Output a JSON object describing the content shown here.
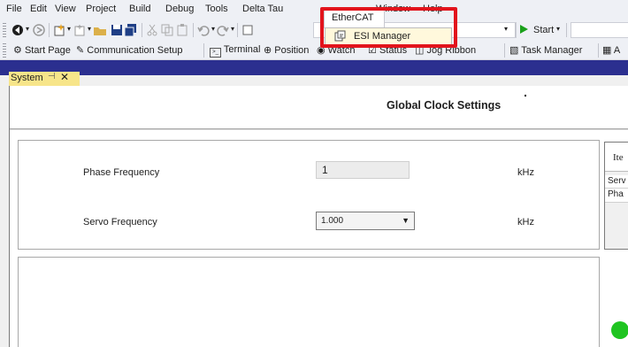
{
  "menubar": {
    "items": [
      {
        "id": "file",
        "label": "File"
      },
      {
        "id": "edit",
        "label": "Edit"
      },
      {
        "id": "view",
        "label": "View"
      },
      {
        "id": "project",
        "label": "Project"
      },
      {
        "id": "build",
        "label": "Build"
      },
      {
        "id": "debug",
        "label": "Debug"
      },
      {
        "id": "tools",
        "label": "Tools"
      },
      {
        "id": "deltatau",
        "label": "Delta Tau"
      },
      {
        "id": "ethercat",
        "label": "EtherCAT"
      },
      {
        "id": "window",
        "label": "Window"
      },
      {
        "id": "help",
        "label": "Help"
      }
    ],
    "dropdown": {
      "item_label": "ESI Manager",
      "icon": "esi-manager-icon"
    }
  },
  "toolbar": {
    "start_label": "Start",
    "links": [
      {
        "label": "Start Page",
        "icon": "gear-icon"
      },
      {
        "label": "Communication Setup",
        "icon": "plug-icon"
      },
      {
        "label": "Terminal",
        "icon": "terminal-icon"
      },
      {
        "label": "Position",
        "icon": "crosshair-icon"
      },
      {
        "label": "Watch",
        "icon": "eye-icon"
      },
      {
        "label": "Status",
        "icon": "checkbox-icon"
      },
      {
        "label": "Jog Ribbon",
        "icon": "jog-icon"
      },
      {
        "label": "Task Manager",
        "icon": "chart-icon"
      }
    ]
  },
  "tab": {
    "label": "System"
  },
  "page": {
    "title": "Global Clock Settings",
    "phase": {
      "label": "Phase Frequency",
      "value": "1",
      "unit": "kHz"
    },
    "servo": {
      "label": "Servo Frequency",
      "value": "1.000",
      "unit": "kHz"
    },
    "table_fragment": {
      "header": "Ite",
      "rows": [
        "Serv",
        "Pha"
      ]
    }
  },
  "colors": {
    "highlight": "#e2141c",
    "tab_strip": "#2b2f8f",
    "active_tab": "#f7e58a",
    "status_dot": "#1fc421"
  }
}
